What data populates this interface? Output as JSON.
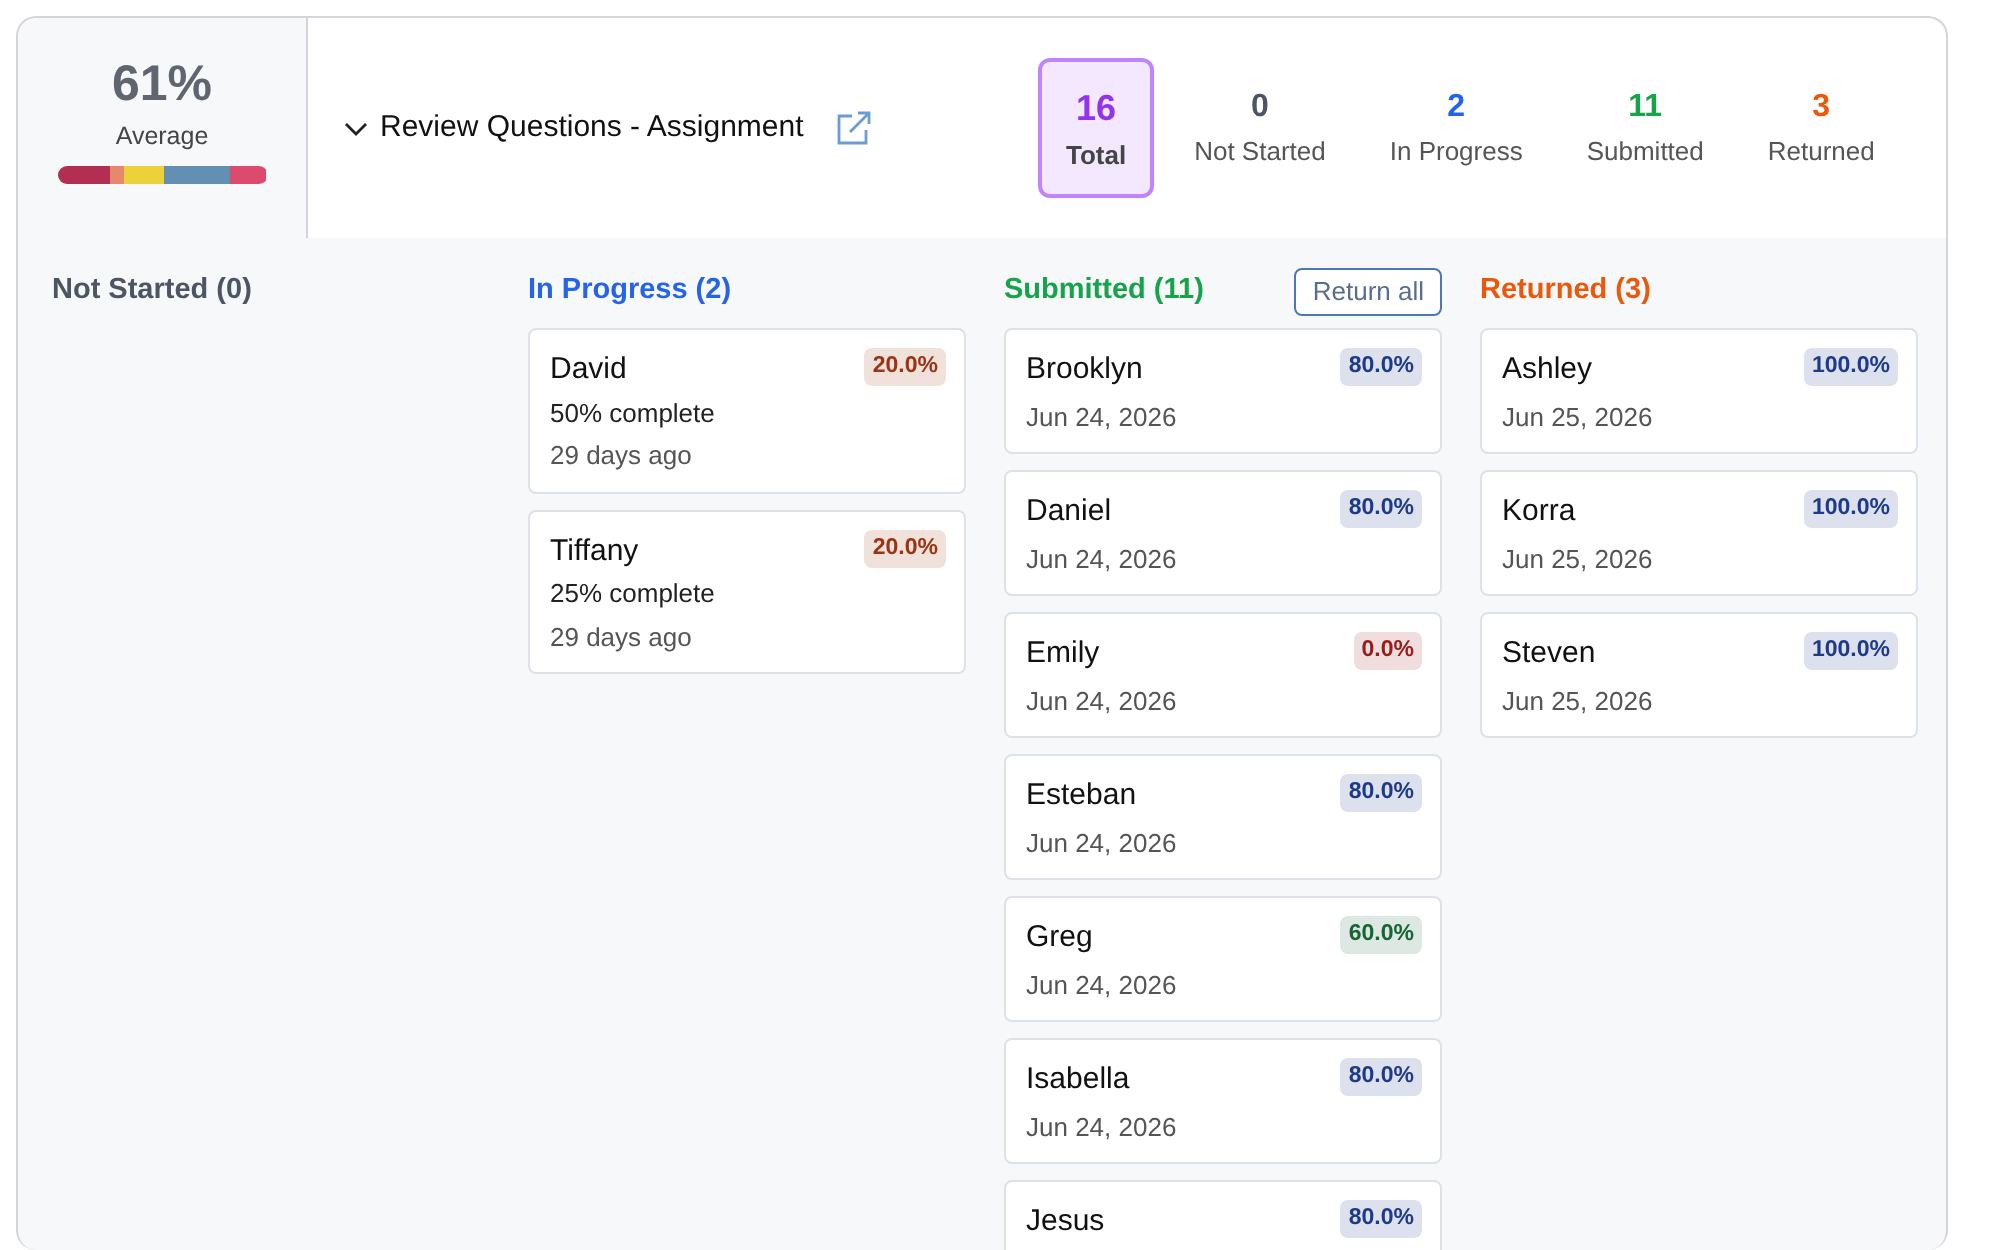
{
  "average": {
    "value": "61%",
    "label": "Average"
  },
  "assignment": {
    "title": "Review Questions - Assignment",
    "expanded": false
  },
  "stats": [
    {
      "count": "16",
      "label": "Total",
      "selected": true,
      "color": "#9333ea"
    },
    {
      "count": "0",
      "label": "Not Started",
      "selected": false,
      "color": "#4b5563"
    },
    {
      "count": "2",
      "label": "In Progress",
      "selected": false,
      "color": "#2563eb"
    },
    {
      "count": "11",
      "label": "Submitted",
      "selected": false,
      "color": "#16a34a"
    },
    {
      "count": "3",
      "label": "Returned",
      "selected": false,
      "color": "#ea580c"
    }
  ],
  "columns": [
    {
      "title": "Not Started (0)",
      "color": "#4b5563"
    },
    {
      "title": "In Progress (2)",
      "color": "#2563eb",
      "cards": [
        {
          "name": "David",
          "score": "20.0%",
          "color": "#9a3412",
          "progress": "50% complete",
          "date": "29 days ago"
        },
        {
          "name": "Tiffany",
          "score": "20.0%",
          "color": "#9a3412",
          "progress": "25% complete",
          "date": "29 days ago"
        }
      ]
    },
    {
      "title": "Submitted (11)",
      "color": "#16a34a",
      "action": "Return all",
      "cards": [
        {
          "name": "Brooklyn",
          "score": "80.0%",
          "color": "#1e3a8a",
          "date": "Jun 24, 2026"
        },
        {
          "name": "Daniel",
          "score": "80.0%",
          "color": "#1e3a8a",
          "date": "Jun 24, 2026"
        },
        {
          "name": "Emily",
          "score": "0.0%",
          "color": "#991b1b",
          "date": "Jun 24, 2026"
        },
        {
          "name": "Esteban",
          "score": "80.0%",
          "color": "#1e3a8a",
          "date": "Jun 24, 2026"
        },
        {
          "name": "Greg",
          "score": "60.0%",
          "color": "#166534",
          "date": "Jun 24, 2026"
        },
        {
          "name": "Isabella",
          "score": "80.0%",
          "color": "#1e3a8a",
          "date": "Jun 24, 2026"
        },
        {
          "name": "Jesus",
          "score": "80.0%",
          "color": "#1e3a8a"
        }
      ]
    },
    {
      "title": "Returned (3)",
      "color": "#ea580c",
      "cards": [
        {
          "name": "Ashley",
          "score": "100.0%",
          "color": "#1e3a8a",
          "date": "Jun 25, 2026"
        },
        {
          "name": "Korra",
          "score": "100.0%",
          "color": "#1e3a8a",
          "date": "Jun 25, 2026"
        },
        {
          "name": "Steven",
          "score": "100.0%",
          "color": "#1e3a8a",
          "date": "Jun 25, 2026"
        }
      ]
    }
  ]
}
